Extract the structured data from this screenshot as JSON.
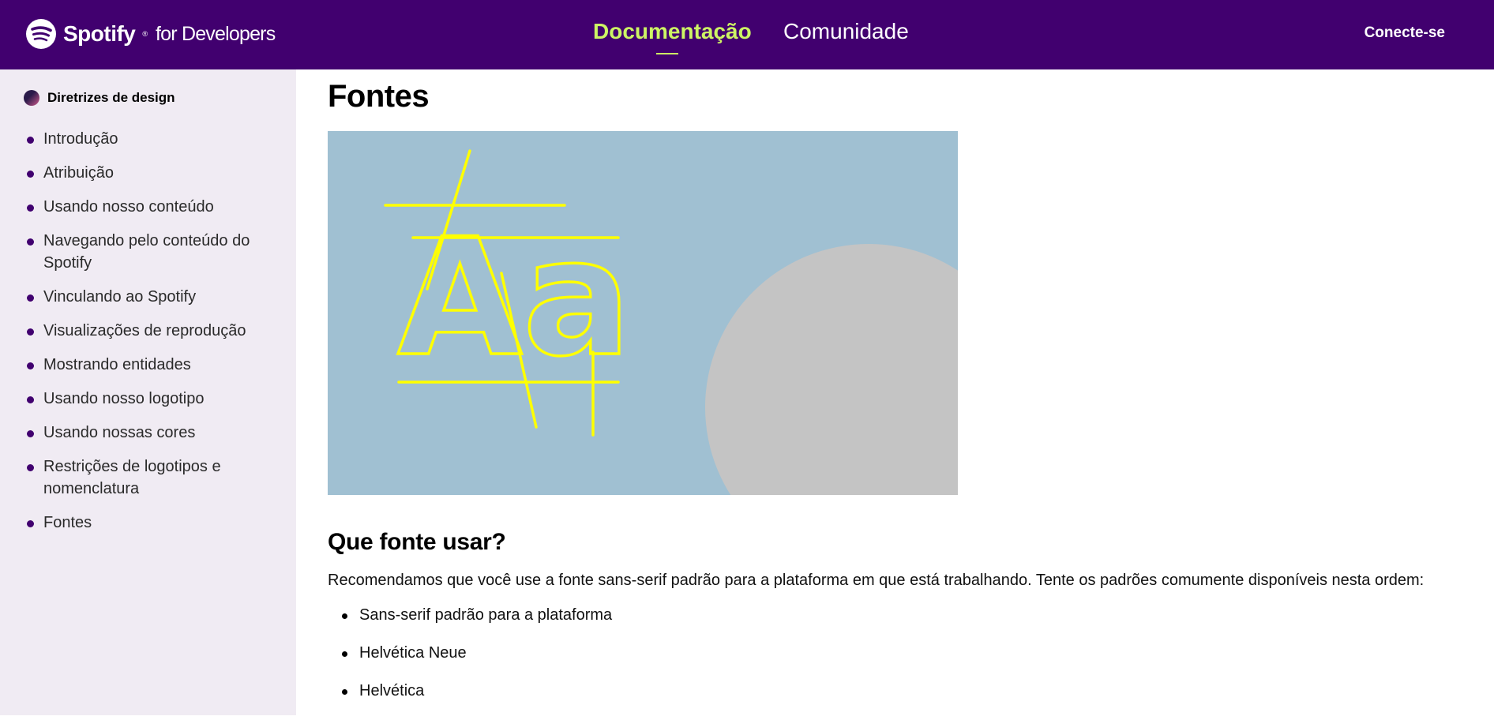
{
  "header": {
    "brand": "Spotify",
    "brand_suffix": "for Developers",
    "nav": [
      {
        "label": "Documentação",
        "active": true
      },
      {
        "label": "Comunidade",
        "active": false
      }
    ],
    "login_label": "Conecte-se",
    "colors": {
      "bar": "#41006f",
      "active": "#cdf564"
    }
  },
  "sidebar": {
    "section_title": "Diretrizes de design",
    "items": [
      {
        "label": "Introdução"
      },
      {
        "label": "Atribuição"
      },
      {
        "label": "Usando nosso conteúdo"
      },
      {
        "label": "Navegando pelo conteúdo do Spotify"
      },
      {
        "label": "Vinculando ao Spotify"
      },
      {
        "label": "Visualizações de reprodução"
      },
      {
        "label": "Mostrando entidades"
      },
      {
        "label": "Usando nosso logotipo"
      },
      {
        "label": "Usando nossas cores"
      },
      {
        "label": "Restrições de logotipos e nomenclatura"
      },
      {
        "label": "Fontes"
      }
    ]
  },
  "main": {
    "title": "Fontes",
    "hero": {
      "glyphs": "Aa",
      "colors": {
        "background": "#a0c0d2",
        "lines": "#ffff00",
        "circle": "#c4c4c4"
      }
    },
    "section_heading": "Que fonte usar?",
    "paragraph": "Recomendamos que você use a fonte sans-serif padrão para a plataforma em que está trabalhando. Tente os padrões comumente disponíveis nesta ordem:",
    "list": [
      "Sans-serif padrão para a plataforma",
      "Helvética Neue",
      "Helvética"
    ]
  }
}
